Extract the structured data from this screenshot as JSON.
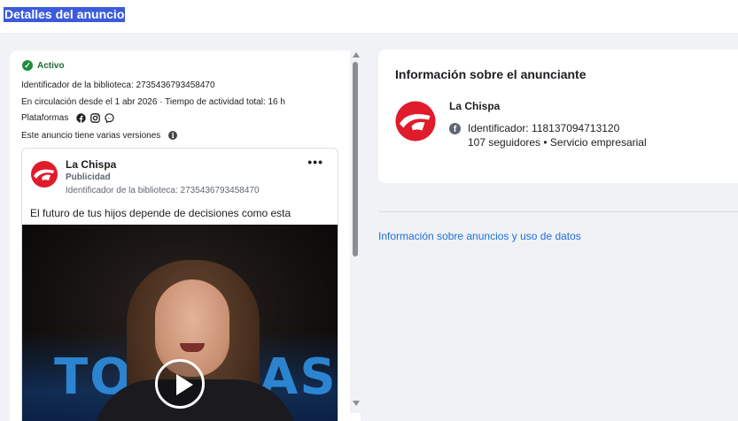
{
  "page": {
    "title": "Detalles del anuncio"
  },
  "ad_summary": {
    "status": "Activo",
    "library_id_line": "Identificador de la biblioteca: 2735436793458470",
    "circulation_line": "En circulación desde el 1 abr 2026 · Tiempo de actividad total: 16 h",
    "platforms_label": "Plataformas",
    "platform_icons": [
      "facebook-icon",
      "instagram-icon",
      "messenger-icon"
    ],
    "versions_line": "Este anuncio tiene varias versiones"
  },
  "ad_card": {
    "advertiser": "La Chispa",
    "sponsored": "Publicidad",
    "library_id_line": "Identificador de la biblioteca: 2735436793458470",
    "more_label": "•••",
    "body_text": "El futuro de tus hijos depende de decisiones como esta",
    "video_text_left": "TO",
    "video_text_right": "AS"
  },
  "advertiser_panel": {
    "title": "Información sobre el anunciante",
    "name": "La Chispa",
    "id_line": "Identificador: 118137094713120",
    "followers_line": "107 seguidores • Servicio empresarial"
  },
  "links": {
    "data_usage": "Información sobre anuncios y uso de datos"
  },
  "colors": {
    "brand_red": "#e01b2b",
    "status_green": "#1e8e3e",
    "link_blue": "#216fdb",
    "title_highlight": "#3b5bdb"
  }
}
